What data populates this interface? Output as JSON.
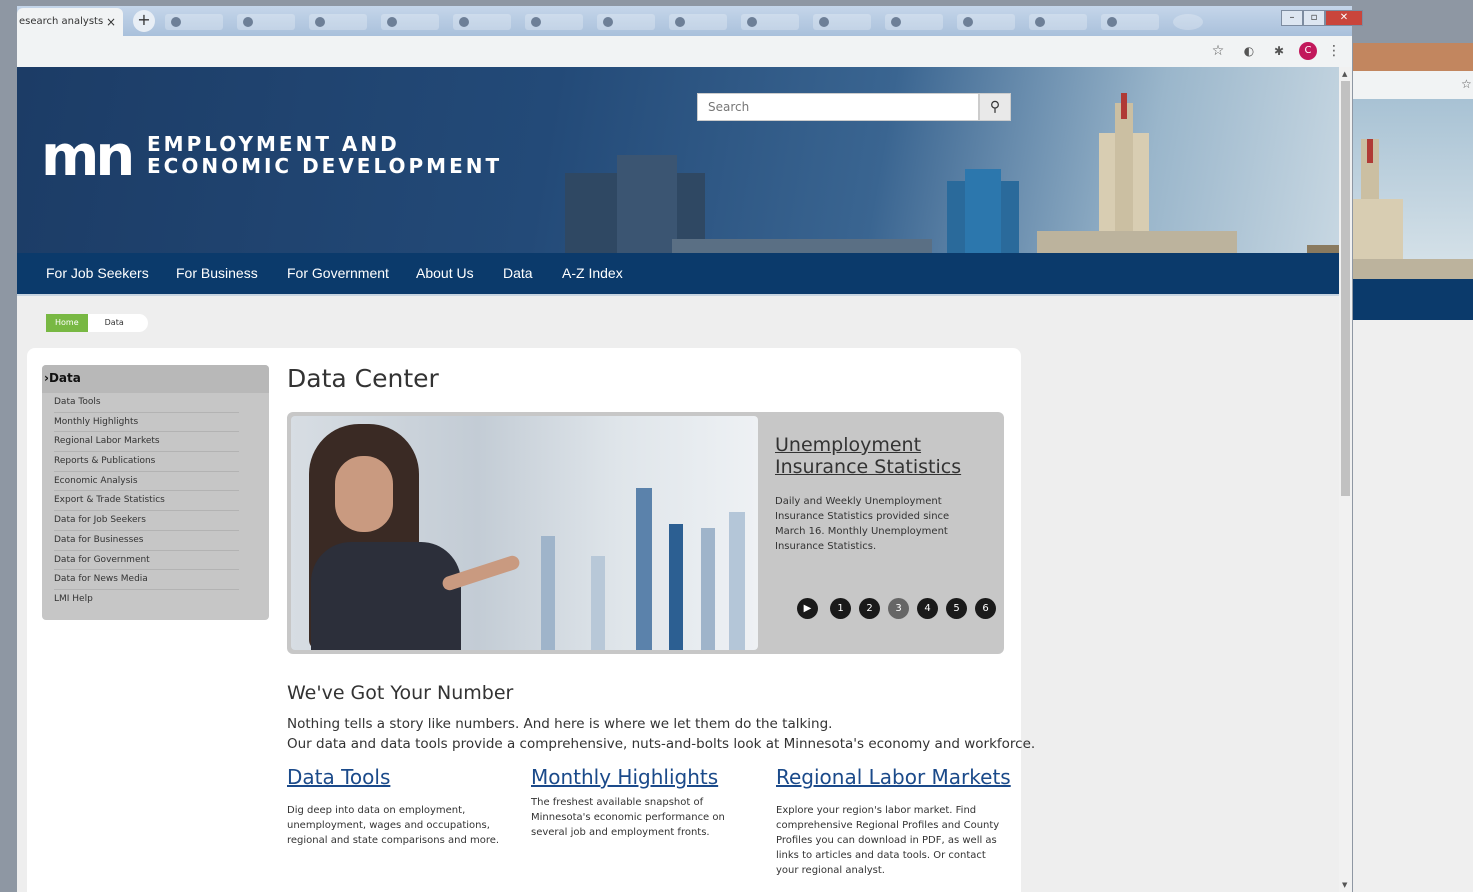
{
  "browser": {
    "active_tab_title": "esearch analysts",
    "close_glyph": "×",
    "new_tab_glyph": "+",
    "bookmark_icon": "☆",
    "extension_icon": "◐",
    "puzzle_icon": "✱",
    "profile_initial": "C",
    "menu_icon": "⋮"
  },
  "header": {
    "logo_mark": "mn",
    "logo_line1": "EMPLOYMENT AND",
    "logo_line2": "ECONOMIC DEVELOPMENT",
    "search_placeholder": "Search",
    "search_icon": "⚲"
  },
  "nav": {
    "items": [
      "For Job Seekers",
      "For Business",
      "For Government",
      "About Us",
      "Data",
      "A-Z Index"
    ]
  },
  "breadcrumb": {
    "home": "Home",
    "current": "Data"
  },
  "sidebar": {
    "heading": "Data",
    "items": [
      "Data Tools",
      "Monthly Highlights",
      "Regional Labor Markets",
      "Reports & Publications",
      "Economic Analysis",
      "Export & Trade Statistics",
      "Data for Job Seekers",
      "Data for Businesses",
      "Data for Government",
      "Data for News Media",
      "LMI Help"
    ]
  },
  "main": {
    "title": "Data Center",
    "carousel": {
      "title": "Unemployment Insurance Statistics",
      "description": "Daily and Weekly Unemployment Insurance Statistics provided since March 16. Monthly Unemployment Insurance Statistics.",
      "play_glyph": "▶",
      "pages": [
        "1",
        "2",
        "3",
        "4",
        "5",
        "6"
      ],
      "active_page": 3
    },
    "section_title": "We've Got Your Number",
    "intro_line1": "Nothing tells a story like numbers. And here is where we let them do the talking.",
    "intro_line2": "Our data and data tools provide a comprehensive, nuts-and-bolts look at Minnesota's economy and workforce.",
    "columns": [
      {
        "title": "Data Tools",
        "desc": "Dig deep into data on employment, unemployment, wages and occupations, regional and state comparisons and more."
      },
      {
        "title": "Monthly Highlights",
        "desc": "The freshest available snapshot of Minnesota's economic performance on several job and employment fronts."
      },
      {
        "title": "Regional Labor Markets",
        "desc": "Explore your region's labor market. Find comprehensive Regional Profiles and County Profiles you can download in PDF, as well as links to articles and data tools. Or contact your regional analyst."
      }
    ]
  }
}
